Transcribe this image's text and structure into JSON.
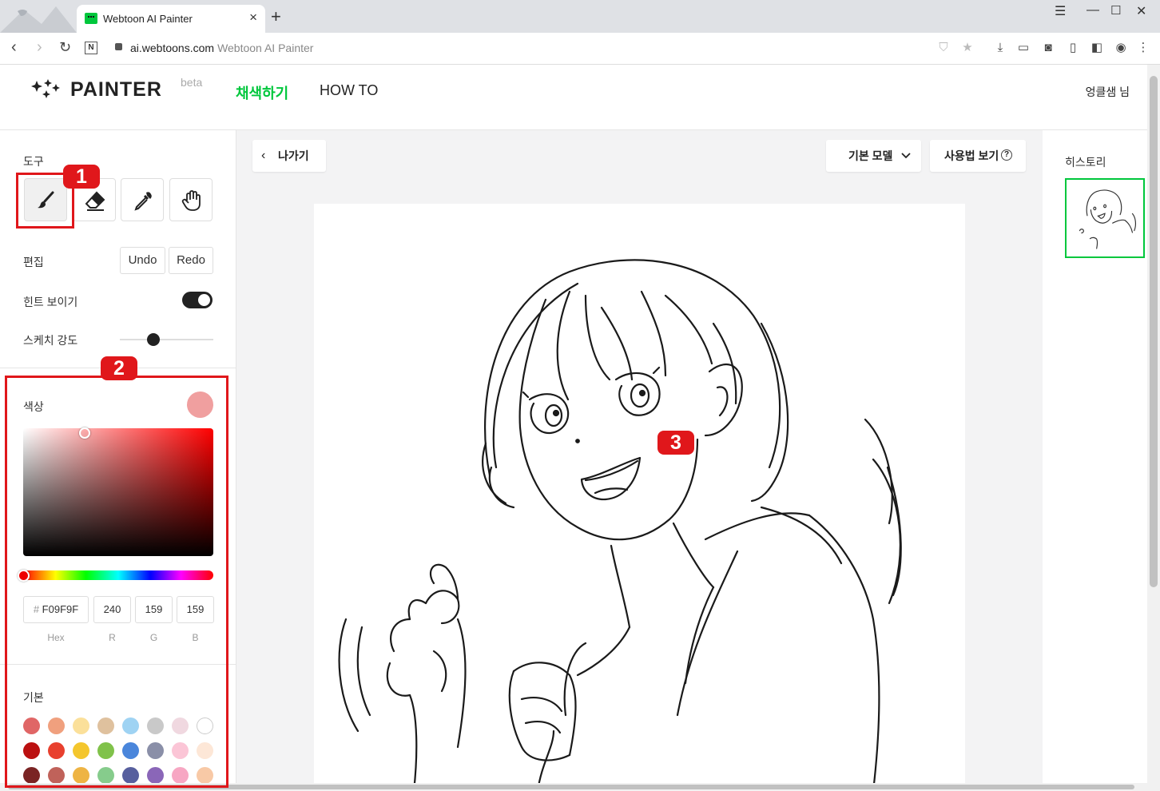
{
  "browser": {
    "tab_title": "Webtoon AI Painter",
    "tab_close": "×",
    "new_tab": "+",
    "url_domain": "ai.webtoons.com",
    "url_title": "Webtoon AI Painter"
  },
  "header": {
    "logo_text": "PAINTER",
    "logo_badge": "beta",
    "nav_color": "채색하기",
    "nav_howto": "HOW TO",
    "username": "엉클샘 님"
  },
  "tools": {
    "label": "도구",
    "items": [
      "brush-icon",
      "eraser-icon",
      "eyedropper-icon",
      "hand-icon"
    ],
    "active": "brush-icon"
  },
  "edit": {
    "label": "편집",
    "undo": "Undo",
    "redo": "Redo"
  },
  "hint": {
    "label": "힌트 보이기",
    "enabled": true
  },
  "sketch": {
    "label": "스케치 강도"
  },
  "color": {
    "label": "색상",
    "current": "#F09F9F",
    "hex_prefix": "#",
    "hex": "F09F9F",
    "r": "240",
    "g": "159",
    "b": "159",
    "hex_label": "Hex",
    "r_label": "R",
    "g_label": "G",
    "b_label": "B"
  },
  "palette": {
    "label": "기본",
    "rows": [
      [
        "#e06666",
        "#f0a07e",
        "#fbe09a",
        "#dfc19e",
        "#9fd3f3",
        "#c9c9c9",
        "#f0d8e0",
        "#ffffff"
      ],
      [
        "#bb1010",
        "#e8402e",
        "#f4c62d",
        "#80c24a",
        "#4a86db",
        "#8a8fa8",
        "#fbc5d6",
        "#fde7d7"
      ],
      [
        "#7a2424",
        "#c0625a",
        "#eeb444",
        "#86cc8c",
        "#575f9e",
        "#8a66b8",
        "#f7a7c3",
        "#f8c9a6"
      ]
    ]
  },
  "toolbar": {
    "back": "나가기",
    "model": "기본 모델",
    "guide": "사용법 보기"
  },
  "history": {
    "label": "히스토리"
  },
  "annotations": {
    "badge1": "1",
    "badge2": "2",
    "badge3": "3"
  }
}
